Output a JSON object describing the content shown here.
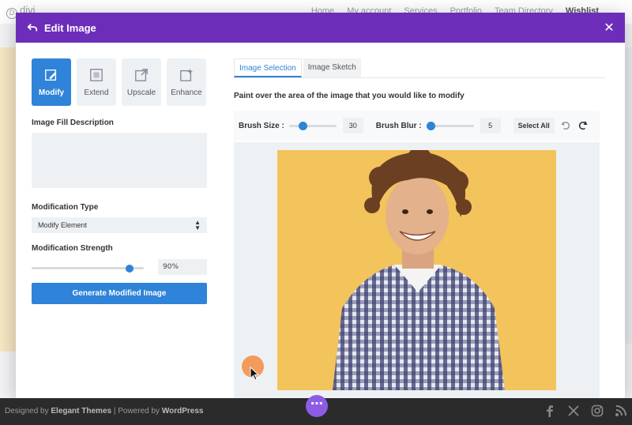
{
  "site": {
    "logo": "divi",
    "nav": [
      "Home",
      "My account",
      "Services",
      "Portfolio",
      "Team Directory",
      "Wishlist"
    ]
  },
  "modal": {
    "title": "Edit Image",
    "modes": [
      "Modify",
      "Extend",
      "Upscale",
      "Enhance"
    ],
    "active_mode": "Modify",
    "fill_label": "Image Fill Description",
    "fill_placeholder": "",
    "type_label": "Modification Type",
    "type_value": "Modify Element",
    "strength_label": "Modification Strength",
    "strength_value": "90%",
    "strength_level": 0.9,
    "generate_label": "Generate Modified Image",
    "view_tabs": [
      "Image Selection",
      "Image Sketch"
    ],
    "active_view": "Image Selection",
    "instruction": "Paint over the area of the image that you would like to modify",
    "brush_size_label": "Brush Size :",
    "brush_size": "30",
    "brush_blur_label": "Brush Blur :",
    "brush_blur": "5",
    "select_all_label": "Select All"
  },
  "footer": {
    "designed_by": "Designed by",
    "elegant": "Elegant Themes",
    "powered_by": " | Powered by",
    "wordpress": "WordPress",
    "social": [
      "facebook-icon",
      "x-icon",
      "instagram-icon",
      "rss-icon"
    ]
  },
  "colors": {
    "header": "#6c2eb9",
    "accent": "#2f83d8",
    "photo_bg": "#f3c35c"
  }
}
